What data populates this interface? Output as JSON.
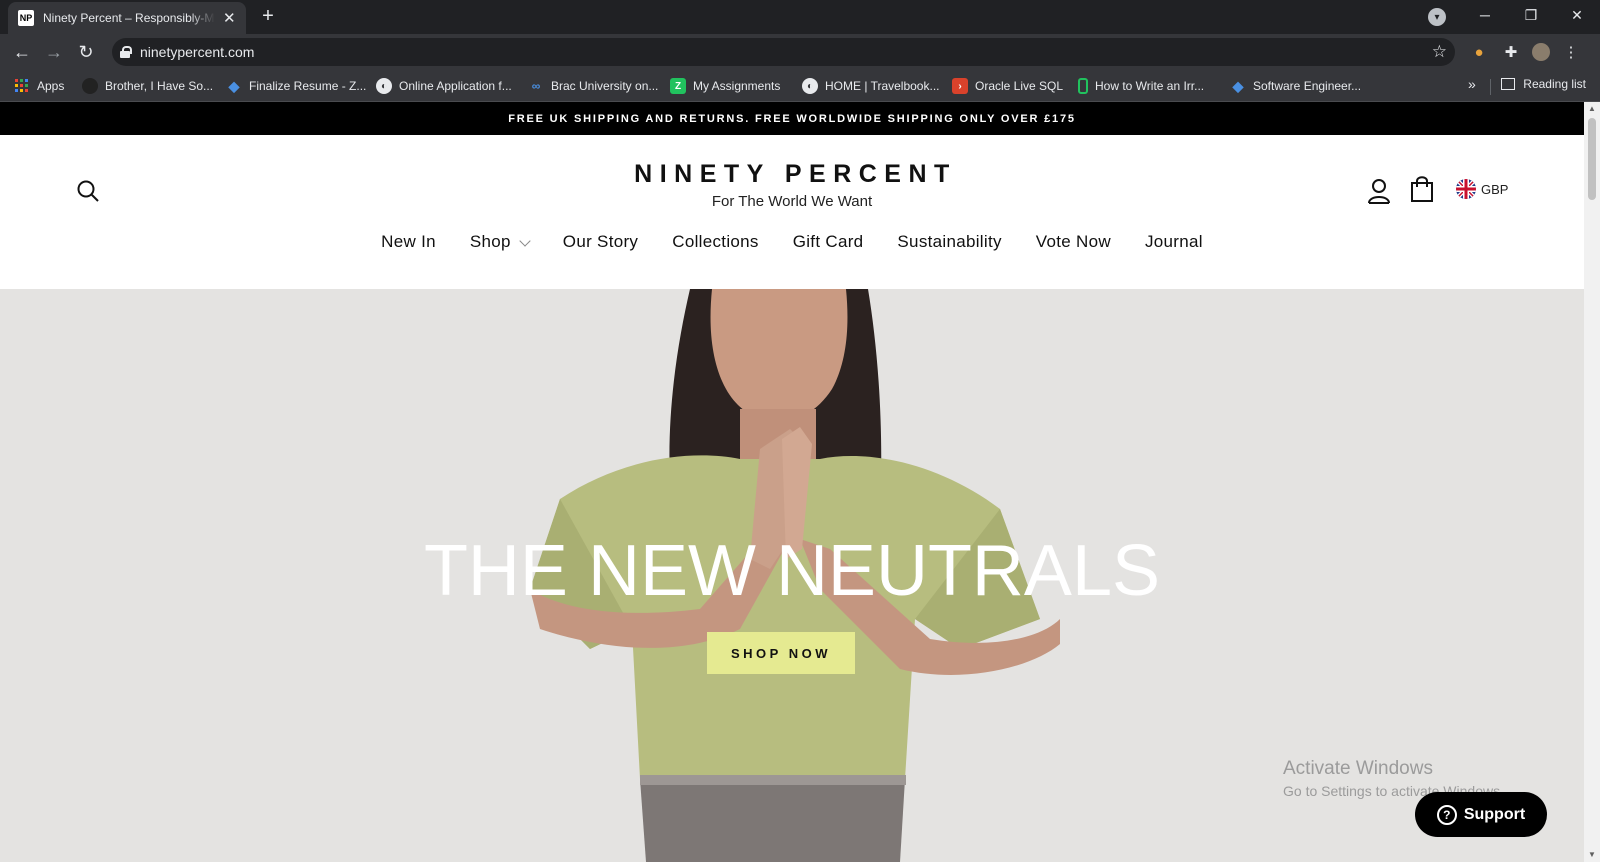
{
  "browser": {
    "tab_title": "Ninety Percent – Responsibly-Made",
    "tab_favicon": "NP",
    "url": "ninetypercent.com",
    "bookmarks": [
      "Apps",
      "Brother, I Have So...",
      "Finalize Resume - Z...",
      "Online Application f...",
      "Brac University on...",
      "My Assignments",
      "HOME | Travelbook...",
      "Oracle Live SQL",
      "How to Write an Irr...",
      "Software Engineer..."
    ],
    "reading_list": "Reading list",
    "more_bookmarks": "»"
  },
  "site": {
    "announcement": "FREE UK SHIPPING AND RETURNS. FREE WORLDWIDE SHIPPING ONLY OVER £175",
    "brand_name": "NINETY PERCENT",
    "tagline": "For The World We Want",
    "currency": "GBP",
    "nav": [
      "New In",
      "Shop",
      "Our Story",
      "Collections",
      "Gift Card",
      "Sustainability",
      "Vote Now",
      "Journal"
    ],
    "hero_title": "THE NEW NEUTRALS",
    "hero_button": "SHOP NOW",
    "support_label": "Support"
  },
  "os_overlay": {
    "line1": "Activate Windows",
    "line2": "Go to Settings to activate Windows."
  },
  "colors": {
    "hero_bg": "#e4e3e1",
    "button_bg": "#e5ea91",
    "announce_bg": "#000000"
  }
}
